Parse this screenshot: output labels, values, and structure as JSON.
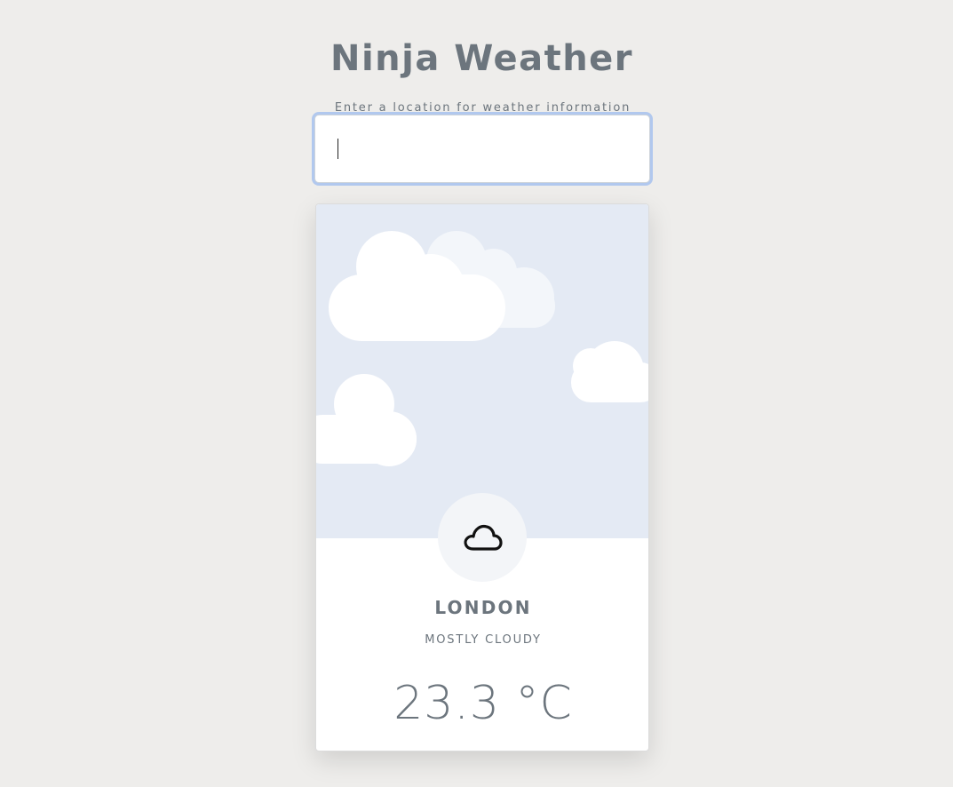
{
  "app": {
    "title": "Ninja Weather"
  },
  "search": {
    "label": "Enter a location for weather information",
    "value": "",
    "placeholder": ""
  },
  "weather": {
    "city": "LONDON",
    "condition": "MOSTLY CLOUDY",
    "temperature": "23.3",
    "unit": "°C",
    "icon": "cloud-icon"
  },
  "colors": {
    "background": "#eeedeb",
    "sky": "#e4eaf4",
    "text": "#6c757d",
    "focus_ring": "#80aaf0"
  }
}
